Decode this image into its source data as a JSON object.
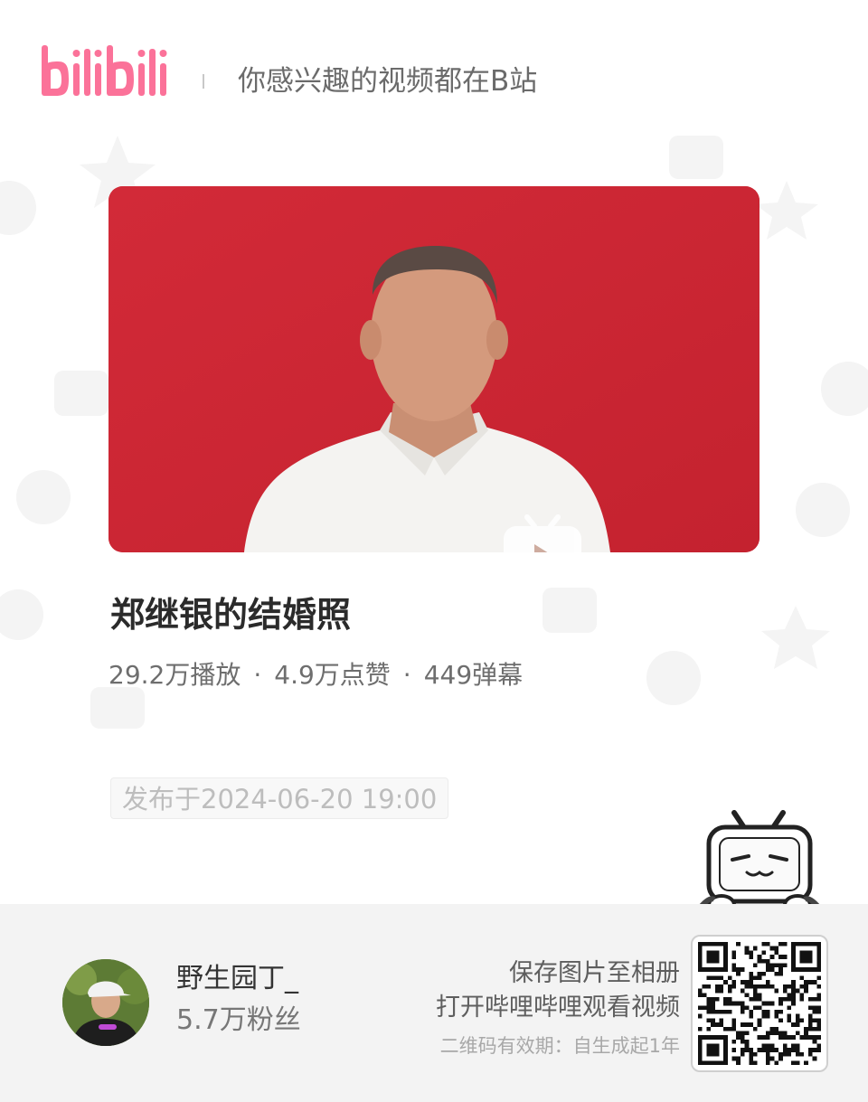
{
  "brand": {
    "logo_text": "bilibili",
    "slogan": "你感兴趣的视频都在B站",
    "brand_color": "#fb7299"
  },
  "video": {
    "title": "郑继银的结婚照",
    "stats": {
      "views": "29.2万播放",
      "likes": "4.9万点赞",
      "danmaku": "449弹幕",
      "separator": "·"
    },
    "publish_time": "发布于2024-06-20 19:00",
    "cover_background": "#cf2a36"
  },
  "uploader": {
    "name": "野生园丁_",
    "followers": "5.7万粉丝"
  },
  "share": {
    "save_hint": "保存图片至相册",
    "open_hint": "打开哔哩哔哩观看视频",
    "validity": "二维码有效期：自生成起1年"
  },
  "icons": {
    "play": "tv-play-icon",
    "mascot": "tv-mascot-icon",
    "qr": "qr-code"
  }
}
